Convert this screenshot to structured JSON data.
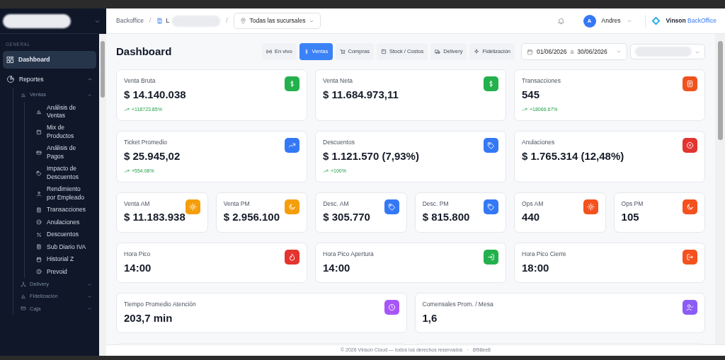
{
  "sidebar": {
    "section": "GENERAL",
    "nav": [
      {
        "kind": "item",
        "label": "Dashboard",
        "selected": true
      },
      {
        "kind": "group",
        "label": "Reportes",
        "expanded": true,
        "children": [
          {
            "label": "Ventas",
            "expanded": true,
            "children": [
              {
                "label": "Análisis de Ventas",
                "selected": false
              },
              {
                "label": "Mix de Productos",
                "selected": false
              },
              {
                "label": "Análisis de Pagos",
                "selected": false
              },
              {
                "label": "Impacto de Descuentos",
                "selected": false
              },
              {
                "label": "Rendimiento por Empleado",
                "selected": false
              },
              {
                "label": "Transacciones",
                "selected": false
              },
              {
                "label": "Anulaciones",
                "selected": false
              },
              {
                "label": "Descuentos",
                "selected": false
              },
              {
                "label": "Sub Diario IVA",
                "selected": false
              },
              {
                "label": "Historial Z",
                "selected": false
              },
              {
                "label": "Prevoid",
                "selected": false
              }
            ]
          },
          {
            "label": "Delivery",
            "expanded": false
          },
          {
            "label": "Fidelización",
            "expanded": false
          },
          {
            "label": "Caja",
            "expanded": false
          }
        ]
      }
    ]
  },
  "header": {
    "breadcrumb": [
      "Backoffice",
      "L"
    ],
    "breadcrumb_separators": [
      "/",
      "/"
    ],
    "branch_select": "Todas las sucursales",
    "user": {
      "initial": "A",
      "name": "Andres"
    },
    "brand": {
      "name": "Vinson",
      "accent": "BackOffice"
    }
  },
  "toolbar": {
    "title": "Dashboard",
    "tabs": [
      {
        "label": "En vivo",
        "selected": false
      },
      {
        "label": "Ventas",
        "selected": true
      },
      {
        "label": "Compras",
        "selected": false
      },
      {
        "label": "Stock / Costos",
        "selected": false
      },
      {
        "label": "Delivery",
        "selected": false
      },
      {
        "label": "Fidelización",
        "selected": false
      }
    ],
    "date_range": {
      "from": "01/06/2026",
      "separator": "a",
      "to": "30/06/2026"
    }
  },
  "card_rows": [
    [
      {
        "kind": "kpi",
        "label": "Venta Bruta",
        "value": "$ 14.140.038",
        "delta": "+118723.85%",
        "color": "#22b14c"
      },
      {
        "kind": "kpi",
        "label": "Venta Neta",
        "value": "$ 11.684.973,11",
        "color": "#22b14c"
      },
      {
        "kind": "kpi",
        "label": "Transacciones",
        "value": "545",
        "delta": "+18066.67%",
        "color": "#f0521f"
      }
    ],
    [
      {
        "kind": "kpi",
        "label": "Ticket Promedio",
        "value": "$ 25.945,02",
        "delta": "+554.08%",
        "color": "#3478f6"
      },
      {
        "kind": "kpi",
        "label": "Descuentos",
        "value": "$ 1.121.570 (7,93%)",
        "delta": "+100%",
        "color": "#3478f6"
      },
      {
        "kind": "kpi",
        "label": "Anulaciones",
        "value": "$ 1.765.314 (12,48%)",
        "color": "#e3342f"
      }
    ],
    [
      {
        "kind": "kpi",
        "label": "Venta AM",
        "value": "$ 11.183.938",
        "color": "#f59e0b"
      },
      {
        "kind": "kpi",
        "label": "Venta PM",
        "value": "$ 2.956.100",
        "color": "#f59e0b"
      },
      {
        "kind": "kpi",
        "label": "Desc. AM",
        "value": "$ 305.770",
        "color": "#3478f6"
      },
      {
        "kind": "kpi",
        "label": "Desc. PM",
        "value": "$ 815.800",
        "color": "#3478f6"
      },
      {
        "kind": "kpi",
        "label": "Ops AM",
        "value": "440",
        "color": "#f4511e"
      },
      {
        "kind": "kpi",
        "label": "Ops PM",
        "value": "105",
        "color": "#f4511e"
      }
    ],
    [
      {
        "kind": "kpi",
        "label": "Hora Pico",
        "value": "14:00",
        "color": "#e3342f"
      },
      {
        "kind": "kpi",
        "label": "Hora Pico Apertura",
        "value": "14:00",
        "color": "#22b14c"
      },
      {
        "kind": "kpi",
        "label": "Hora Pico Cierre",
        "value": "18:00",
        "color": "#f4511e"
      }
    ],
    [
      {
        "kind": "kpi",
        "label": "Tiempo Promedio Atención",
        "value": "203,7 min",
        "color": "#a855f7"
      },
      {
        "kind": "kpi",
        "label": "Comensales Prom. / Mesa",
        "value": "1,6",
        "color": "#8b5cf6"
      }
    ],
    [
      {
        "kind": "cut"
      },
      {
        "kind": "cut"
      }
    ]
  ],
  "footer": {
    "text": "© 2026 Vinson Cloud — todos los derechos reservados",
    "separator": "·",
    "build": "6f98ee8"
  }
}
